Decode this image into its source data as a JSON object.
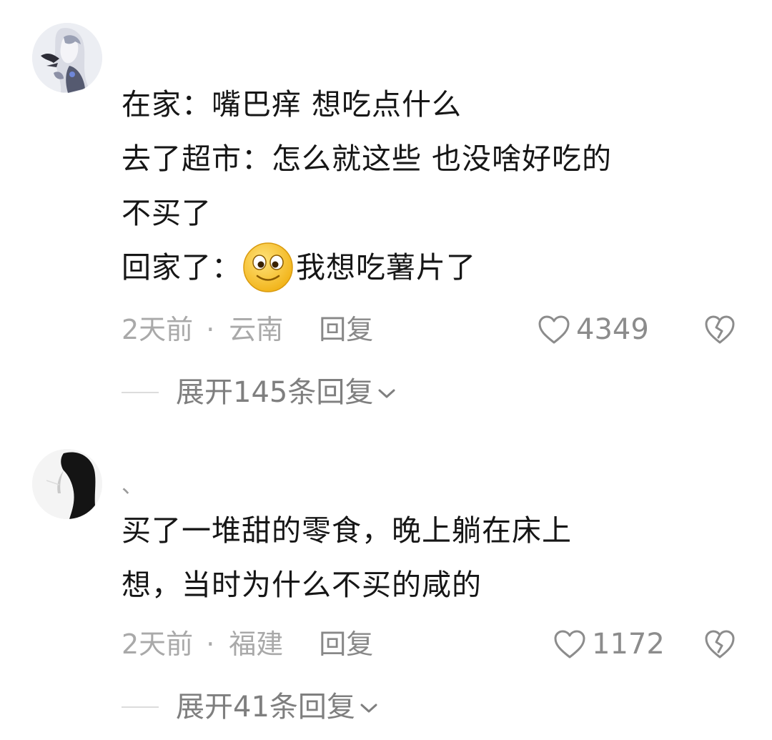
{
  "comments": [
    {
      "username": "",
      "lines": [
        "在家：嘴巴痒 想吃点什么",
        "去了超市：怎么就这些 也没啥好吃的",
        "不买了"
      ],
      "last_line_prefix": "回家了：",
      "emoji": "smiling-face-emoji",
      "last_line_suffix": "我想吃薯片了",
      "time": "2天前",
      "separator": "·",
      "location": "云南",
      "reply_label": "回复",
      "like_count": "4349",
      "expand_label": "展开145条回复"
    },
    {
      "username": "、",
      "lines": [
        "买了一堆甜的零食，晚上躺在床上",
        "想，当时为什么不买的咸的"
      ],
      "time": "2天前",
      "separator": "·",
      "location": "福建",
      "reply_label": "回复",
      "like_count": "1172",
      "expand_label": "展开41条回复"
    }
  ],
  "icons": {
    "like": "heart-outline-icon",
    "dislike": "broken-heart-icon",
    "expand": "chevron-down-icon"
  },
  "colors": {
    "text": "#161616",
    "meta": "#a9a9a9",
    "reply": "#888888",
    "like": "#8c8c8c",
    "emoji_yellow": "#f7c531"
  }
}
